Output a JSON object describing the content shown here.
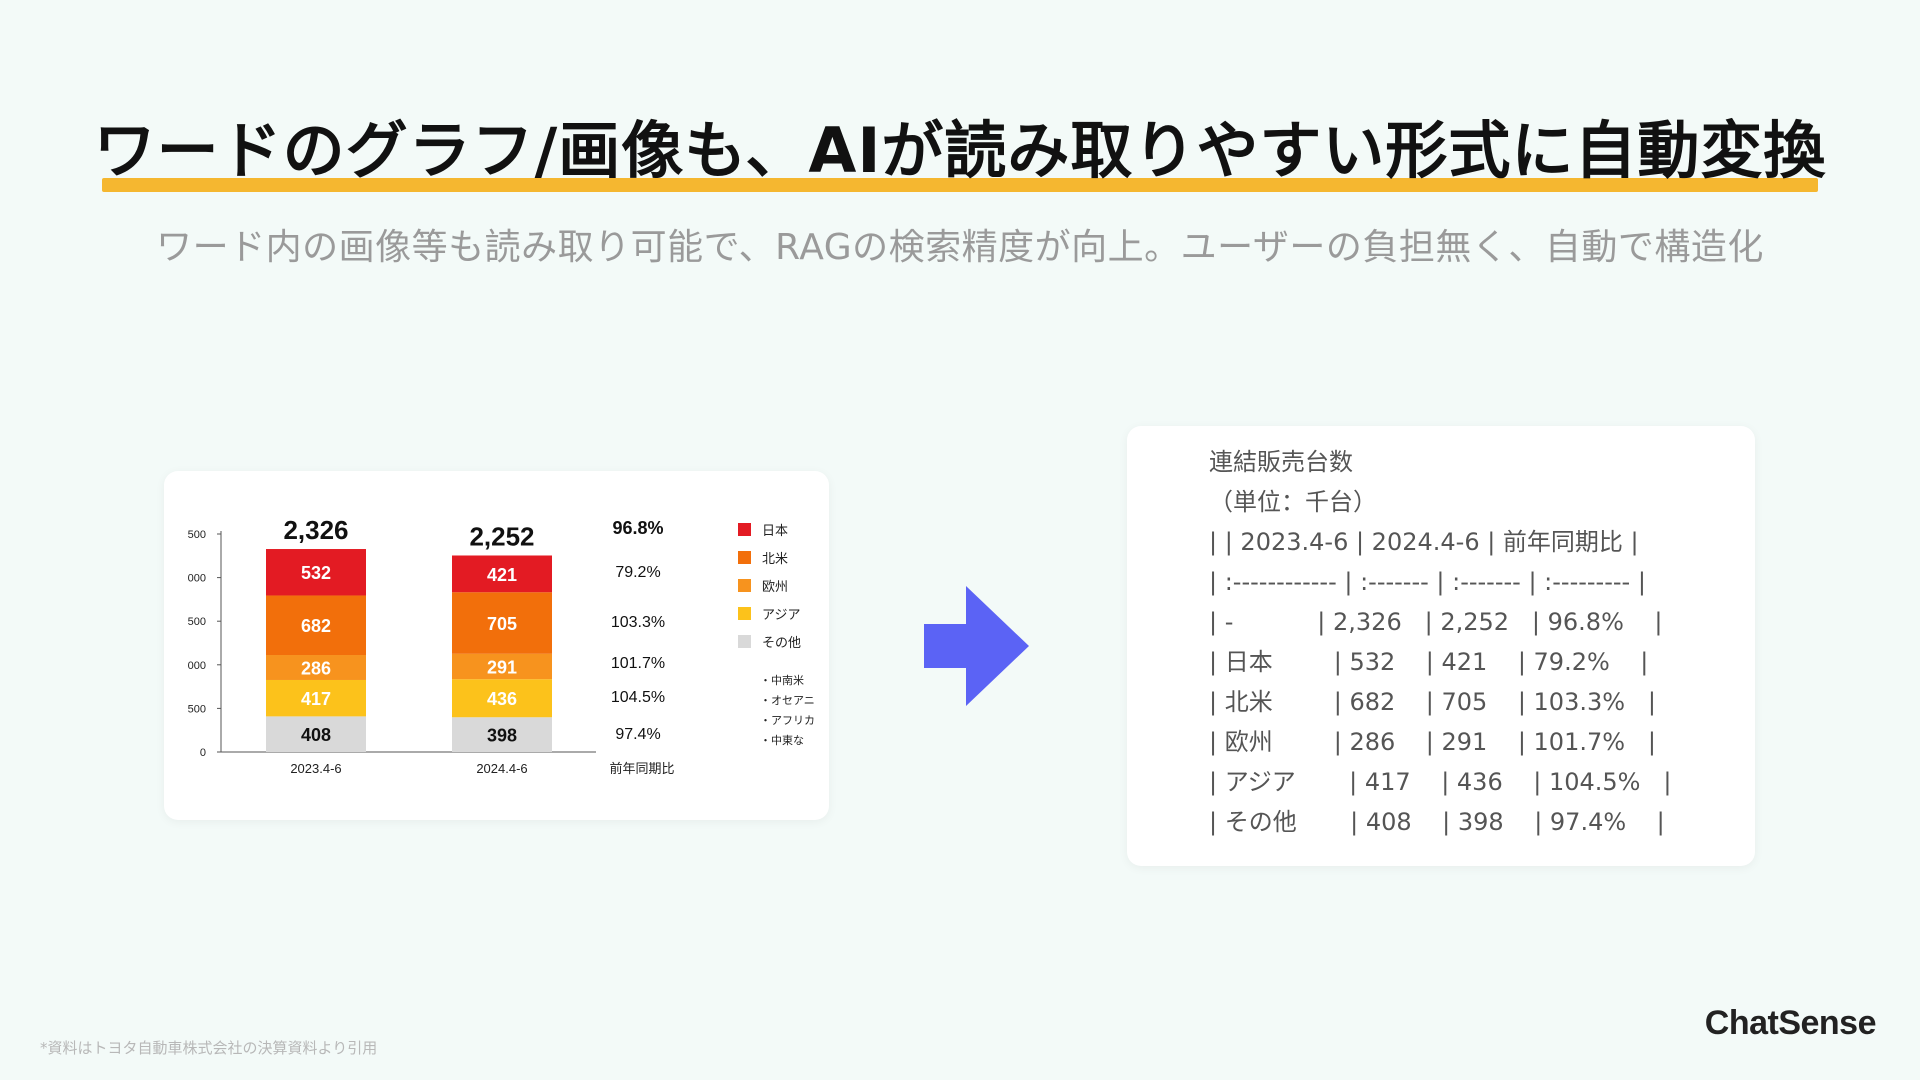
{
  "title": "ワードのグラフ/画像も、AIが読み取りやすい形式に自動変換",
  "subtitle": "ワード内の画像等も読み取り可能で、RAGの検索精度が向上。ユーザーの負担無く、自動で構造化",
  "colors": {
    "highlight": "#f5b730",
    "arrow": "#5b63f5",
    "japan": "#e31b23",
    "north_america": "#f26f0b",
    "europe": "#f7931e",
    "asia": "#fcc21b",
    "other": "#d9d9d9"
  },
  "chart_data": {
    "type": "bar",
    "stacked": true,
    "categories": [
      "2023.4-6",
      "2024.4-6"
    ],
    "series": [
      {
        "name": "その他",
        "values": [
          408,
          398
        ]
      },
      {
        "name": "アジア",
        "values": [
          417,
          436
        ]
      },
      {
        "name": "欧州",
        "values": [
          286,
          291
        ]
      },
      {
        "name": "北米",
        "values": [
          682,
          705
        ]
      },
      {
        "name": "日本",
        "values": [
          532,
          421
        ]
      }
    ],
    "totals": [
      "2,326",
      "2,252"
    ],
    "y_tick_labels": [
      "0",
      "500",
      "000",
      "500",
      "000",
      "500"
    ],
    "yoy_header": "前年同期比",
    "yoy_values": [
      "96.8%",
      "79.2%",
      "103.3%",
      "101.7%",
      "104.5%",
      "97.4%"
    ],
    "legend_sub_items": [
      "・中南米",
      "・オセアニ",
      "・アフリカ",
      "・中東な"
    ]
  },
  "markdown_lines": [
    "連結販売台数",
    "（単位：千台）",
    "| | 2023.4-6 | 2024.4-6 | 前年同期比 |",
    "| :------------ | :------- | :------- | :--------- |",
    "| -           | 2,326   | 2,252   | 96.8%    |",
    "| 日本        | 532    | 421    | 79.2%    |",
    "| 北米        | 682    | 705    | 103.3%   |",
    "| 欧州        | 286    | 291    | 101.7%   |",
    "| アジア       | 417    | 436    | 104.5%   |",
    "| その他       | 408    | 398    | 97.4%    |"
  ],
  "footnote": "*資料はトヨタ自動車株式会社の決算資料より引用",
  "brand": "ChatSense"
}
